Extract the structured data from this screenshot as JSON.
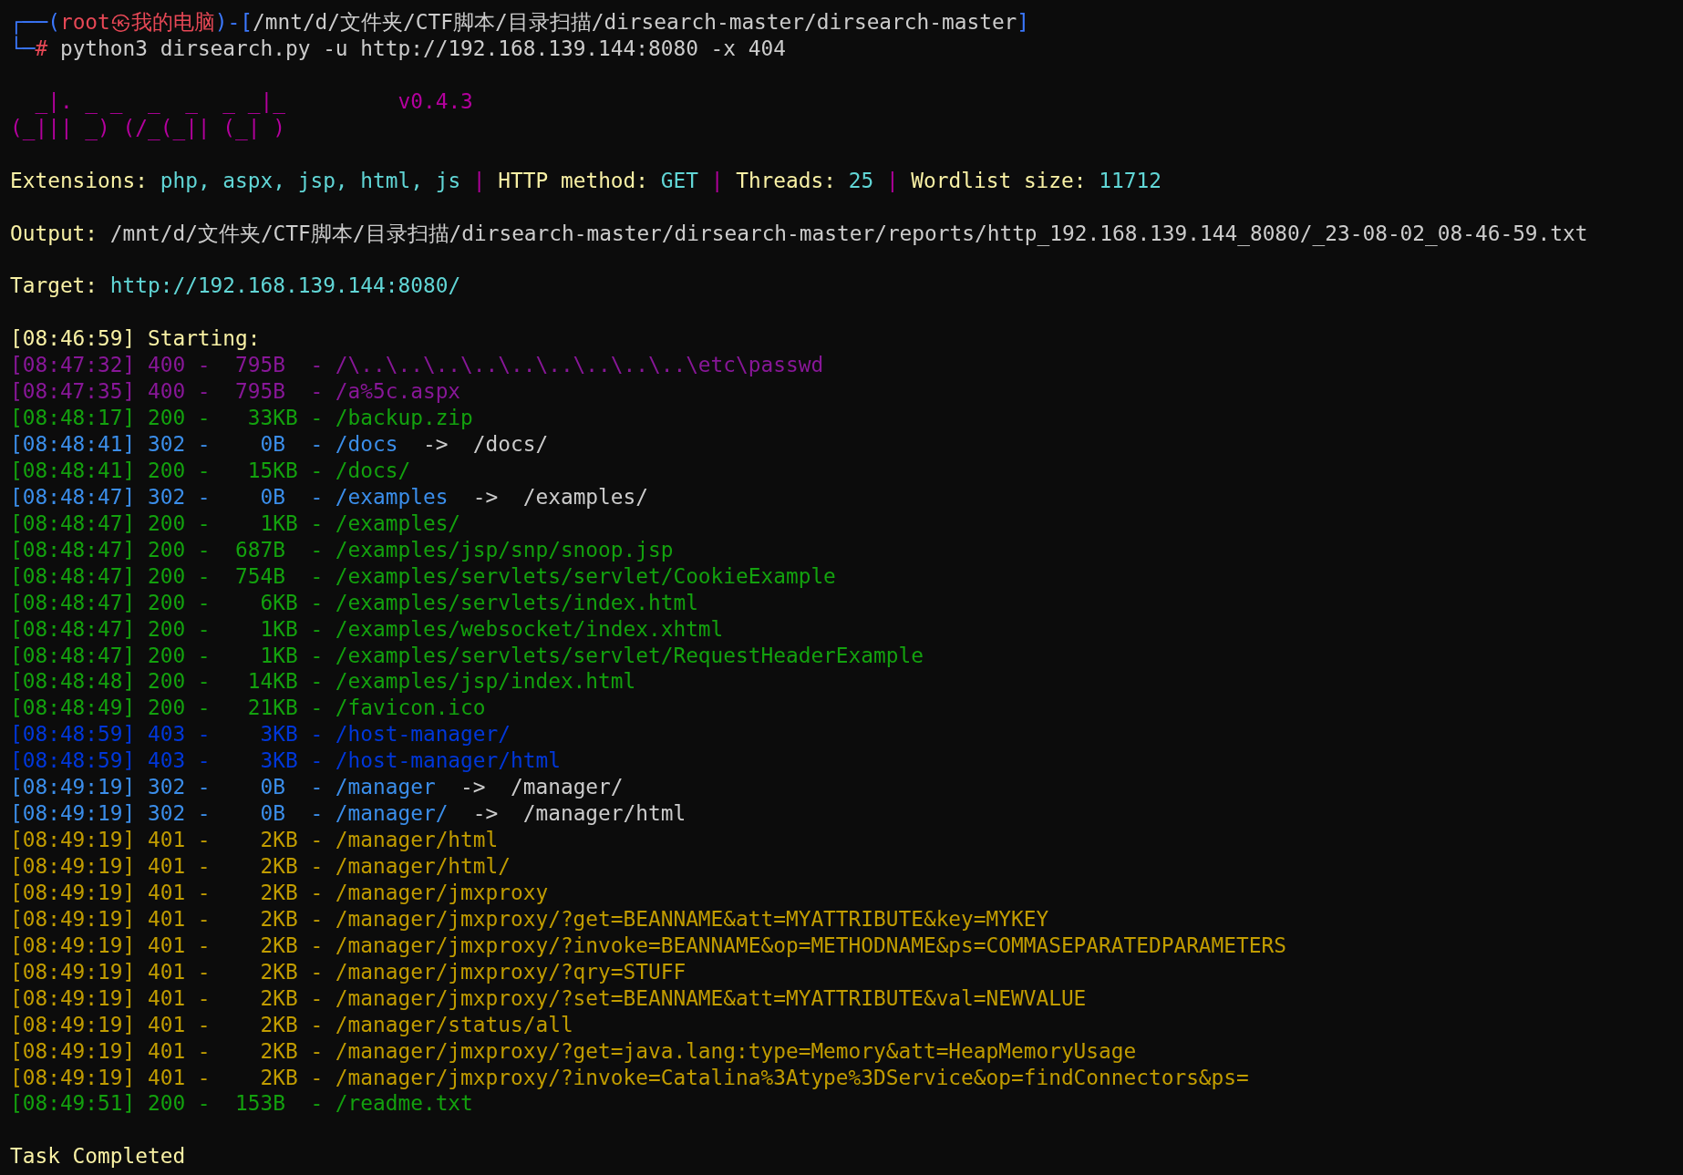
{
  "prompt": {
    "corner_top": "┌──(",
    "user": "root㉿我的电脑",
    "joiner": ")-[",
    "path": "/mnt/d/文件夹/CTF脚本/目录扫描/dirsearch-master/dirsearch-master",
    "close": "]",
    "corner_bottom": "└─",
    "symbol": "#",
    "command": "python3 dirsearch.py -u http://192.168.139.144:8080 -x 404"
  },
  "banner": {
    "logo_lines": [
      "  _|. _ _  _  _  _ _|_",
      "(_||| _) (/_(_|| (_| )"
    ],
    "version": "v0.4.3"
  },
  "config": [
    {
      "label": "Extensions:",
      "value": "php, aspx, jsp, html, js",
      "separator": "|"
    },
    {
      "label": "HTTP method:",
      "value": "GET",
      "separator": "|"
    },
    {
      "label": "Threads:",
      "value": "25",
      "separator": "|"
    },
    {
      "label": "Wordlist size:",
      "value": "11712"
    }
  ],
  "output": {
    "label": "Output:",
    "value": "/mnt/d/文件夹/CTF脚本/目录扫描/dirsearch-master/dirsearch-master/reports/http_192.168.139.144_8080/_23-08-02_08-46-59.txt"
  },
  "target": {
    "label": "Target:",
    "value": "http://192.168.139.144:8080/"
  },
  "start_line": "[08:46:59] Starting:",
  "log": [
    {
      "text": "[08:47:32] 400 -  795B  - /\\..\\..\\..\\..\\..\\..\\..\\..\\..\\etc\\passwd",
      "color": "#881798"
    },
    {
      "text": "[08:47:35] 400 -  795B  - /a%5c.aspx",
      "color": "#881798"
    },
    {
      "text": "[08:48:17] 200 -   33KB - /backup.zip",
      "color": "#13a10e"
    },
    {
      "text": "[08:48:41] 302 -    0B  - /docs",
      "color": "#3b8eea",
      "redirect": "->  /docs/"
    },
    {
      "text": "[08:48:41] 200 -   15KB - /docs/",
      "color": "#13a10e"
    },
    {
      "text": "[08:48:47] 302 -    0B  - /examples",
      "color": "#3b8eea",
      "redirect": "->  /examples/"
    },
    {
      "text": "[08:48:47] 200 -    1KB - /examples/",
      "color": "#13a10e"
    },
    {
      "text": "[08:48:47] 200 -  687B  - /examples/jsp/snp/snoop.jsp",
      "color": "#13a10e"
    },
    {
      "text": "[08:48:47] 200 -  754B  - /examples/servlets/servlet/CookieExample",
      "color": "#13a10e"
    },
    {
      "text": "[08:48:47] 200 -    6KB - /examples/servlets/index.html",
      "color": "#13a10e"
    },
    {
      "text": "[08:48:47] 200 -    1KB - /examples/websocket/index.xhtml",
      "color": "#13a10e"
    },
    {
      "text": "[08:48:47] 200 -    1KB - /examples/servlets/servlet/RequestHeaderExample",
      "color": "#13a10e"
    },
    {
      "text": "[08:48:48] 200 -   14KB - /examples/jsp/index.html",
      "color": "#13a10e"
    },
    {
      "text": "[08:48:49] 200 -   21KB - /favicon.ico",
      "color": "#13a10e"
    },
    {
      "text": "[08:48:59] 403 -    3KB - /host-manager/",
      "color": "#0037da"
    },
    {
      "text": "[08:48:59] 403 -    3KB - /host-manager/html",
      "color": "#0037da"
    },
    {
      "text": "[08:49:19] 302 -    0B  - /manager",
      "color": "#3b8eea",
      "redirect": "->  /manager/"
    },
    {
      "text": "[08:49:19] 302 -    0B  - /manager/",
      "color": "#3b8eea",
      "redirect": "->  /manager/html"
    },
    {
      "text": "[08:49:19] 401 -    2KB - /manager/html",
      "color": "#c19c00"
    },
    {
      "text": "[08:49:19] 401 -    2KB - /manager/html/",
      "color": "#c19c00"
    },
    {
      "text": "[08:49:19] 401 -    2KB - /manager/jmxproxy",
      "color": "#c19c00"
    },
    {
      "text": "[08:49:19] 401 -    2KB - /manager/jmxproxy/?get=BEANNAME&att=MYATTRIBUTE&key=MYKEY",
      "color": "#c19c00"
    },
    {
      "text": "[08:49:19] 401 -    2KB - /manager/jmxproxy/?invoke=BEANNAME&op=METHODNAME&ps=COMMASEPARATEDPARAMETERS",
      "color": "#c19c00"
    },
    {
      "text": "[08:49:19] 401 -    2KB - /manager/jmxproxy/?qry=STUFF",
      "color": "#c19c00"
    },
    {
      "text": "[08:49:19] 401 -    2KB - /manager/jmxproxy/?set=BEANNAME&att=MYATTRIBUTE&val=NEWVALUE",
      "color": "#c19c00"
    },
    {
      "text": "[08:49:19] 401 -    2KB - /manager/status/all",
      "color": "#c19c00"
    },
    {
      "text": "[08:49:19] 401 -    2KB - /manager/jmxproxy/?get=java.lang:type=Memory&att=HeapMemoryUsage",
      "color": "#c19c00"
    },
    {
      "text": "[08:49:19] 401 -    2KB - /manager/jmxproxy/?invoke=Catalina%3Atype%3DService&op=findConnectors&ps=",
      "color": "#c19c00"
    },
    {
      "text": "[08:49:51] 200 -  153B  - /readme.txt",
      "color": "#13a10e"
    }
  ],
  "end_line": "Task Completed"
}
